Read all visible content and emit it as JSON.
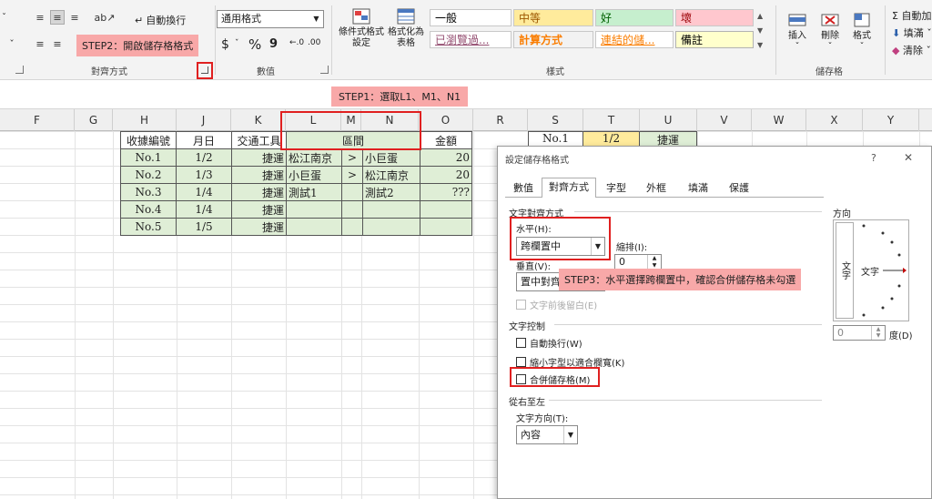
{
  "ribbon": {
    "groups": {
      "alignment": "對齊方式",
      "number": "數值",
      "styles": "樣式",
      "cells": "儲存格"
    },
    "wrap_text": "自動換行",
    "number_format": "通用格式",
    "currency_symbol": "$",
    "percent_symbol": "%",
    "comma_symbol": "9",
    "cond_format": "條件式格式\n設定",
    "format_table": "格式化為\n表格",
    "cell_styles": [
      {
        "label": "一般",
        "bg": "#ffffff",
        "fg": "#000000"
      },
      {
        "label": "中等",
        "bg": "#ffeb9c",
        "fg": "#9c5700"
      },
      {
        "label": "好",
        "bg": "#c6efce",
        "fg": "#006100"
      },
      {
        "label": "壞",
        "bg": "#ffc7ce",
        "fg": "#9c0006"
      },
      {
        "label": "已瀏覽過...",
        "bg": "#ffffff",
        "fg": "#954f72"
      },
      {
        "label": "計算方式",
        "bg": "#f2f2f2",
        "fg": "#fa7d00"
      },
      {
        "label": "連結的儲...",
        "bg": "#ffffff",
        "fg": "#fa7d00"
      },
      {
        "label": "備註",
        "bg": "#ffffcc",
        "fg": "#000000"
      }
    ],
    "insert": "插入",
    "delete": "刪除",
    "format": "格式",
    "autosum": "Σ 自動加",
    "fill": "填滿",
    "clear": "清除"
  },
  "callouts": {
    "step1": "STEP1：選取L1、M1、N1",
    "step2": "STEP2：開啟儲存格格式",
    "step3": "STEP3：水平選擇跨欄置中，確認合併儲存格未勾選"
  },
  "columns": [
    "F",
    "G",
    "H",
    "J",
    "K",
    "L",
    "M",
    "N",
    "O",
    "R",
    "S",
    "T",
    "U",
    "V",
    "W",
    "X",
    "Y"
  ],
  "sheet": {
    "headers": [
      "收據編號",
      "月日",
      "交通工具",
      "區間",
      "金額"
    ],
    "rows": [
      [
        "No.1",
        "1/2",
        "捷運",
        "松江南京",
        ">",
        "小巨蛋",
        "20"
      ],
      [
        "No.2",
        "1/3",
        "捷運",
        "小巨蛋",
        ">",
        "松江南京",
        "20"
      ],
      [
        "No.3",
        "1/4",
        "捷運",
        "測試1",
        "",
        "測試2",
        "???"
      ],
      [
        "No.4",
        "1/4",
        "捷運",
        "",
        "",
        "",
        ""
      ],
      [
        "No.5",
        "1/5",
        "捷運",
        "",
        "",
        "",
        ""
      ]
    ],
    "side_row": [
      "No.1",
      "1/2",
      "捷運"
    ]
  },
  "dialog": {
    "title": "設定儲存格格式",
    "help": "?",
    "close": "✕",
    "tabs": [
      "數值",
      "對齊方式",
      "字型",
      "外框",
      "填滿",
      "保護"
    ],
    "active_tab": 1,
    "text_alignment": "文字對齊方式",
    "horizontal_label": "水平(H):",
    "horizontal_value": "跨欄置中",
    "indent_label": "縮排(I):",
    "indent_value": "0",
    "vertical_label": "垂直(V):",
    "vertical_value": "置中對齊",
    "justify_distributed": "文字前後留白(E)",
    "text_control": "文字控制",
    "wrap": "自動換行(W)",
    "shrink": "縮小字型以適合欄寬(K)",
    "merge": "合併儲存格(M)",
    "rtl": "從右至左",
    "direction_label": "文字方向(T):",
    "direction_value": "內容",
    "orientation": "方向",
    "vertical_text": "文字",
    "orient_text": "文字",
    "degrees_value": "0",
    "degrees_label": "度(D)"
  }
}
